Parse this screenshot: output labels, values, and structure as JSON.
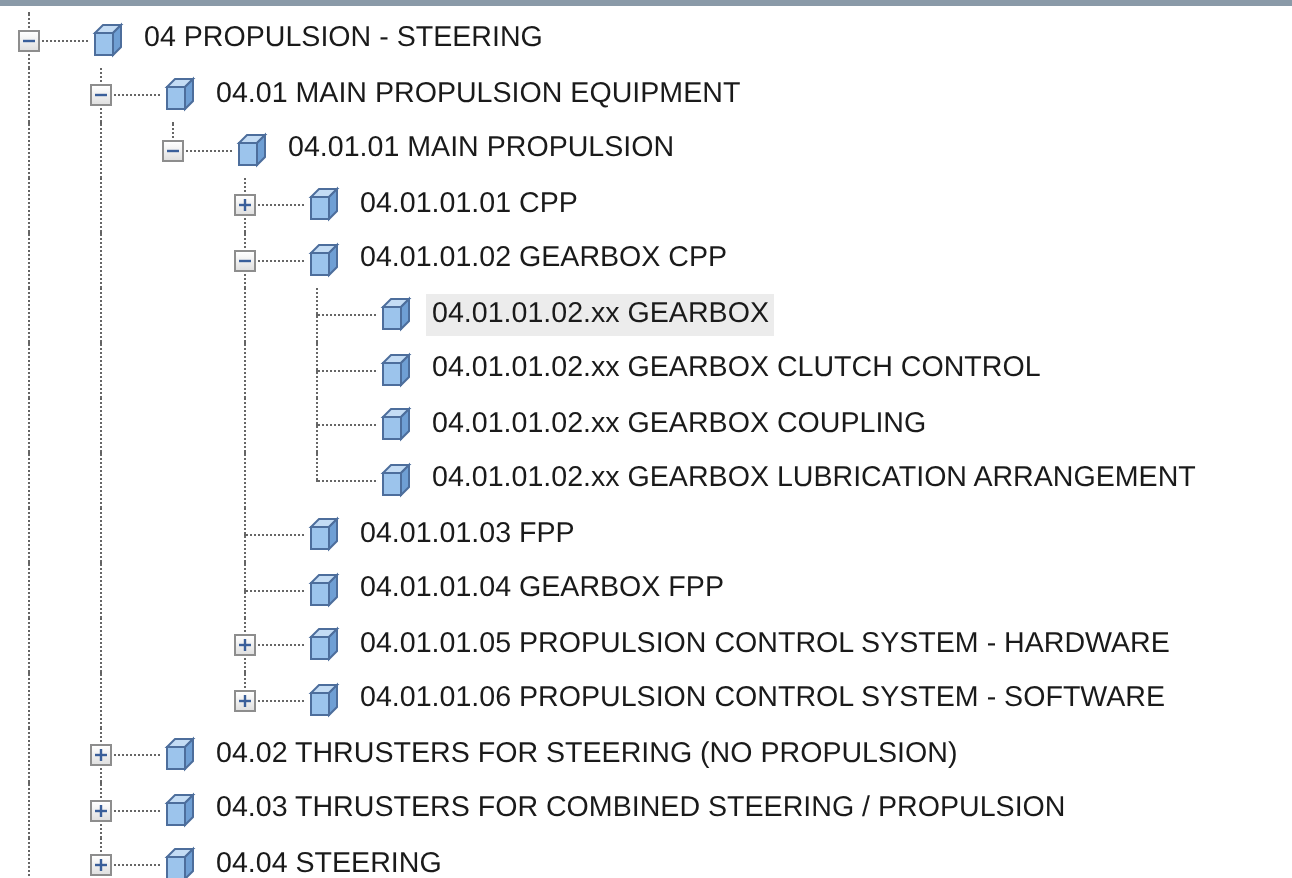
{
  "tree": [
    {
      "label": "04 PROPULSION - STEERING",
      "selected": false,
      "expanded": true,
      "children": [
        {
          "label": "04.01 MAIN PROPULSION EQUIPMENT",
          "selected": false,
          "expanded": true,
          "children": [
            {
              "label": "04.01.01 MAIN PROPULSION",
              "selected": false,
              "expanded": true,
              "children": [
                {
                  "label": "04.01.01.01 CPP",
                  "selected": false,
                  "expanded": false
                },
                {
                  "label": "04.01.01.02 GEARBOX CPP",
                  "selected": false,
                  "expanded": true,
                  "children": [
                    {
                      "label": "04.01.01.02.xx GEARBOX",
                      "selected": true
                    },
                    {
                      "label": "04.01.01.02.xx GEARBOX CLUTCH CONTROL",
                      "selected": false
                    },
                    {
                      "label": "04.01.01.02.xx GEARBOX COUPLING",
                      "selected": false
                    },
                    {
                      "label": "04.01.01.02.xx GEARBOX LUBRICATION ARRANGEMENT",
                      "selected": false
                    }
                  ]
                },
                {
                  "label": "04.01.01.03 FPP",
                  "selected": false
                },
                {
                  "label": "04.01.01.04 GEARBOX FPP",
                  "selected": false
                },
                {
                  "label": "04.01.01.05 PROPULSION CONTROL SYSTEM - HARDWARE",
                  "selected": false,
                  "expanded": false
                },
                {
                  "label": "04.01.01.06 PROPULSION CONTROL SYSTEM - SOFTWARE",
                  "selected": false,
                  "expanded": false
                }
              ]
            }
          ]
        },
        {
          "label": "04.02 THRUSTERS FOR STEERING (NO PROPULSION)",
          "selected": false,
          "expanded": false
        },
        {
          "label": "04.03 THRUSTERS FOR COMBINED STEERING / PROPULSION",
          "selected": false,
          "expanded": false
        },
        {
          "label": "04.04 STEERING",
          "selected": false,
          "expanded": false
        }
      ]
    }
  ]
}
